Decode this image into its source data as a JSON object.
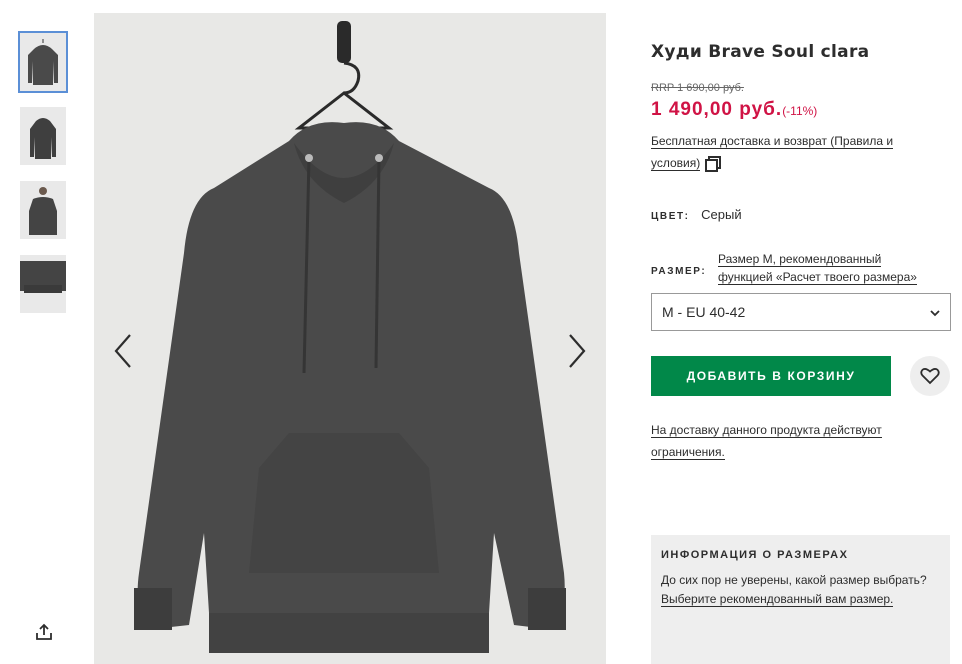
{
  "product": {
    "title": "Худи Brave Soul clara",
    "rrp": "RRP 1 690,00 руб.",
    "price": "1 490,00 руб.",
    "discount": "(-11%)",
    "delivery_text": "Бесплатная доставка и возврат (Правила и условия)"
  },
  "color": {
    "label": "ЦВЕТ:",
    "value": "Серый"
  },
  "size": {
    "label": "РАЗМЕР:",
    "recommendation_line1": "Размер M, рекомендованный",
    "recommendation_line2": "функцией «Расчет твоего размера»",
    "selected": "M - EU 40-42"
  },
  "actions": {
    "add_to_cart": "ДОБАВИТЬ В КОРЗИНУ"
  },
  "restriction": {
    "text": "На доставку данного продукта действуют ограничения."
  },
  "size_info": {
    "heading": "ИНФОРМАЦИЯ О РАЗМЕРАХ",
    "text": "До сих пор не уверены, какой размер выбрать?",
    "link": "Выберите рекомендованный вам размер."
  },
  "icons": {
    "prev": "chevron-left-icon",
    "next": "chevron-right-icon",
    "share": "share-icon",
    "wishlist": "heart-icon",
    "dropdown": "chevron-down-icon",
    "popup": "copy-icon"
  },
  "colors": {
    "accent_green": "#018849",
    "price_red": "#d01345",
    "garment": "#4a4a4a",
    "background_gallery": "#e8e8e6"
  }
}
